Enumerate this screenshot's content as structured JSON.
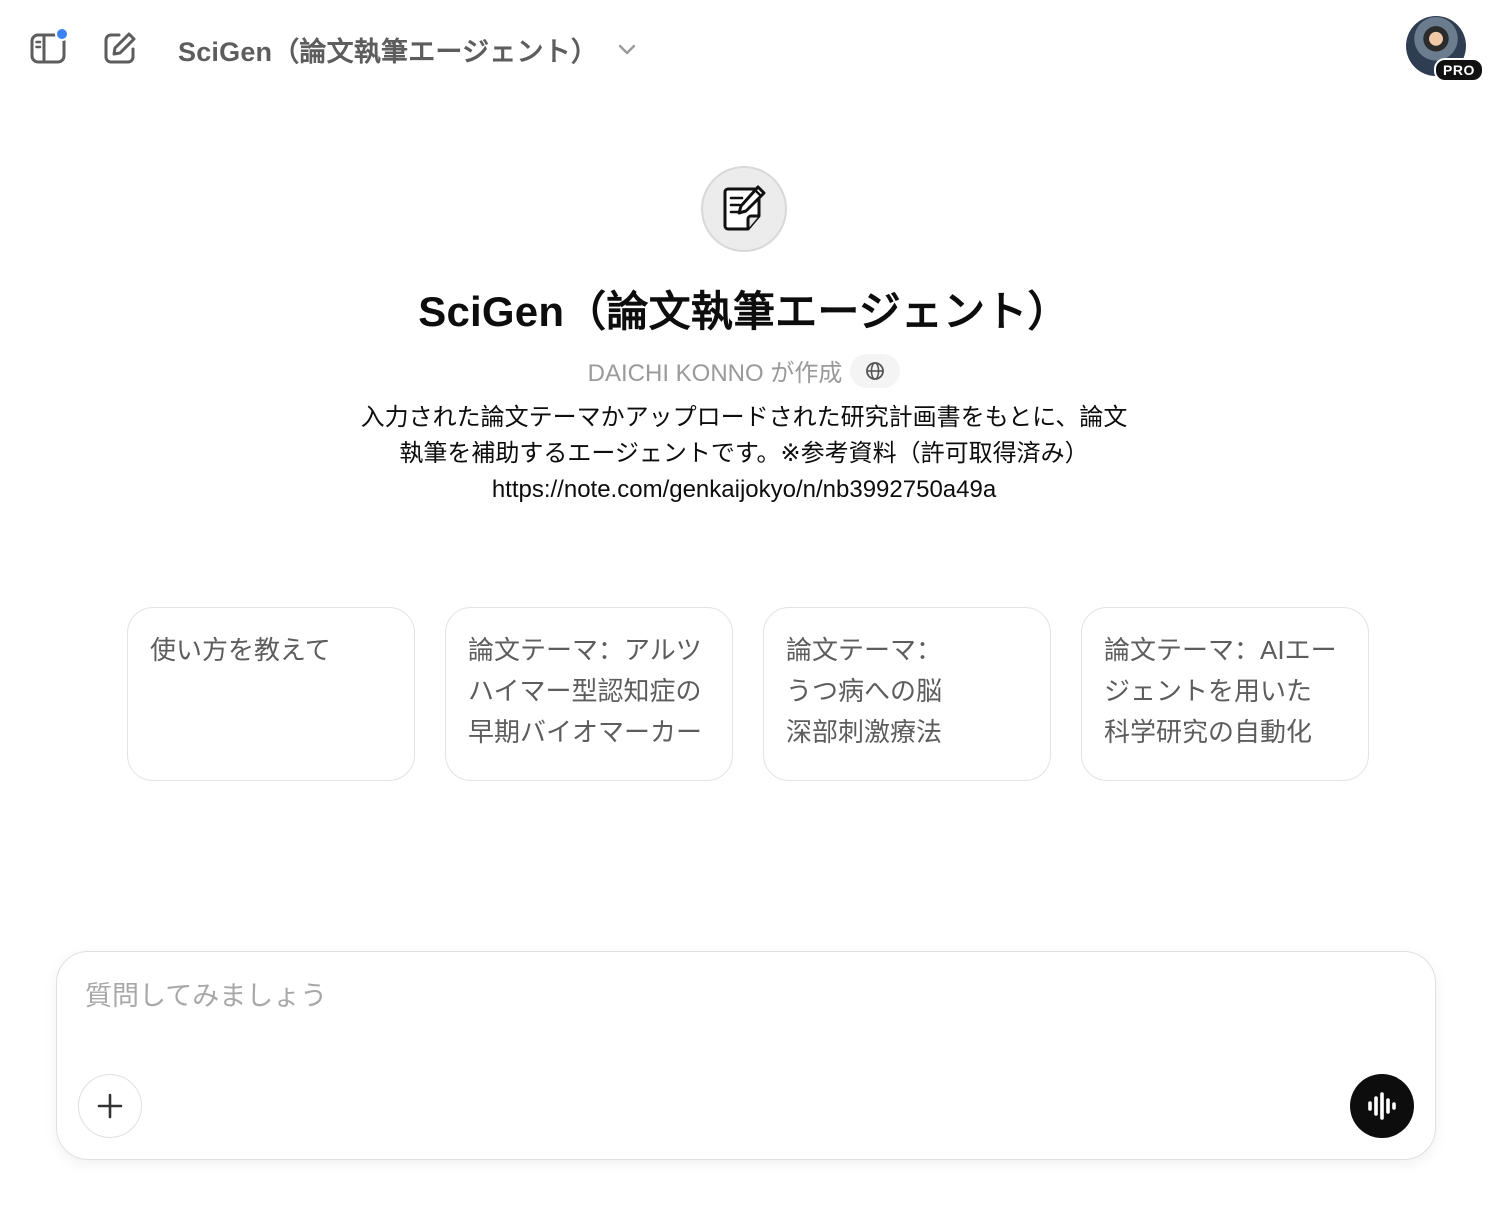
{
  "header": {
    "sidebar_icon": "sidebar-toggle-icon",
    "new_chat_icon": "new-chat-icon",
    "model_title": "SciGen（論文執筆エージェント）",
    "chevron_icon": "chevron-down-icon",
    "badge": "PRO",
    "notification_color": "#3b82f6"
  },
  "gpt": {
    "icon": "document-pen-icon",
    "name": "SciGen（論文執筆エージェント）",
    "author": "DAICHI KONNO が作成",
    "globe_icon": "globe-icon",
    "description_line1": "入力された論文テーマかアップロードされた研究計画書をもとに、論文",
    "description_line2": "執筆を補助するエージェントです。※参考資料（許可取得済み）",
    "description_line3": "https://note.com/genkaijokyo/n/nb3992750a49a"
  },
  "starters": [
    {
      "lines": [
        "使い方を教えて"
      ]
    },
    {
      "lines": [
        "論文テーマ：アルツ",
        "ハイマー型認知症の",
        "早期バイオマーカー"
      ]
    },
    {
      "lines": [
        "論文テーマ：",
        "うつ病への脳",
        "深部刺激療法"
      ]
    },
    {
      "lines": [
        "論文テーマ：AIエー",
        "ジェントを用いた",
        "科学研究の自動化"
      ]
    }
  ],
  "composer": {
    "placeholder": "質問してみましょう",
    "value": "",
    "plus_icon": "plus-icon",
    "voice_icon": "voice-mode-icon"
  }
}
